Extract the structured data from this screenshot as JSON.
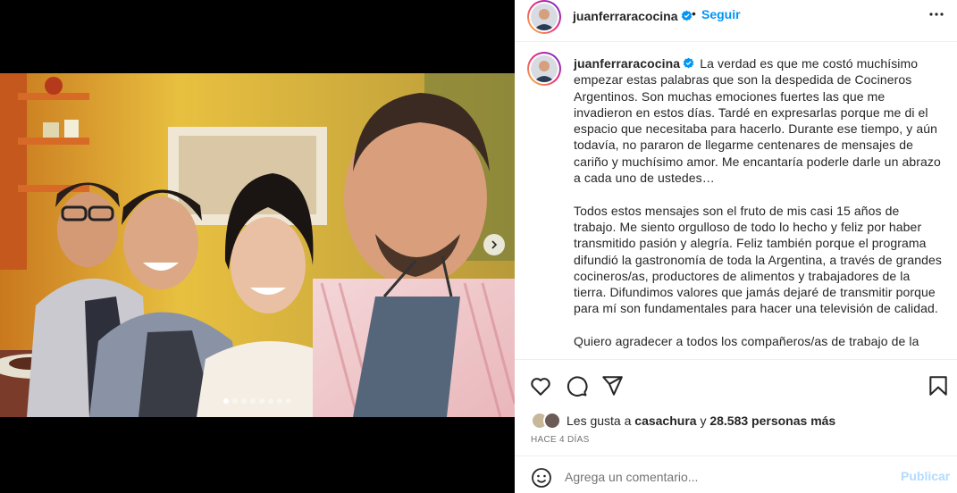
{
  "post": {
    "username": "juanferraracocina",
    "follow_label": "Seguir",
    "separator": "•",
    "caption_paragraphs": [
      "La verdad es que me costó muchísimo empezar estas palabras que son la despedida de Cocineros Argentinos. Son muchas emociones fuertes las que me invadieron en estos días. Tardé en expresarlas porque me di el espacio que necesitaba para hacerlo. Durante ese tiempo, y aún todavía, no pararon de llegarme centenares de mensajes de cariño y muchísimo amor. Me encantaría poderle darle un abrazo a cada uno de ustedes…",
      "Todos estos mensajes son el fruto de mis casi 15 años de trabajo. Me siento orgulloso de todo lo hecho y feliz por haber transmitido pasión y alegría. Feliz también porque el programa difundió la gastronomía de toda la Argentina, a través de grandes cocineros/as, productores de alimentos y trabajadores de la tierra. Difundimos valores que jamás dejaré de transmitir porque para mí son fundamentales para hacer una televisión de calidad.",
      "Quiero agradecer a todos los compañeros/as de trabajo de la"
    ],
    "likes_prefix": "Les gusta a",
    "liked_by": "casachura",
    "likes_conjunction": "y",
    "likes_count": "28.583 personas más",
    "time_ago": "HACE 4 DÍAS",
    "comment_placeholder": "Agrega un comentario...",
    "publish_label": "Publicar",
    "carousel": {
      "total_slides": 8,
      "active_index": 0
    }
  },
  "icons": {
    "more": "more-horizontal-icon",
    "like": "heart-icon",
    "comment": "comment-icon",
    "share": "send-icon",
    "save": "bookmark-icon",
    "emoji": "emoji-icon",
    "next": "chevron-right-icon",
    "verified": "verified-badge-icon"
  },
  "colors": {
    "link_blue": "#0095f6",
    "publish_disabled": "#b3dbff",
    "text": "#262626",
    "secondary": "#737373",
    "verified": "#0095f6"
  }
}
